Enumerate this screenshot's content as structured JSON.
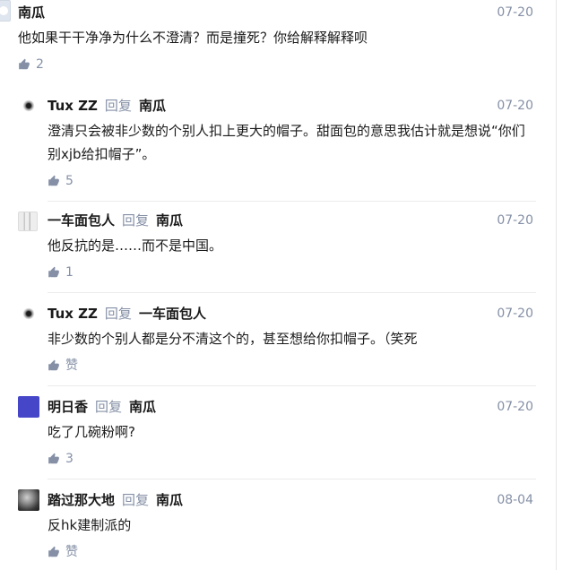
{
  "root_comment": {
    "author": "南瓜",
    "date": "07-20",
    "content": "他如果干干净净为什么不澄清？而是撞死？你给解释解释呗",
    "likes": "2"
  },
  "replies": [
    {
      "author": "Tux ZZ",
      "reply_label": "回复",
      "reply_to": "南瓜",
      "date": "07-20",
      "content": "澄清只会被非少数的个别人扣上更大的帽子。甜面包的意思我估计就是想说“你们别xjb给扣帽子”。",
      "likes": "5"
    },
    {
      "author": "一车面包人",
      "reply_label": "回复",
      "reply_to": "南瓜",
      "date": "07-20",
      "content": "他反抗的是……而不是中国。",
      "likes": "1"
    },
    {
      "author": "Tux ZZ",
      "reply_label": "回复",
      "reply_to": "一车面包人",
      "date": "07-20",
      "content": "非少数的个别人都是分不清这个的，甚至想给你扣帽子。（笑死",
      "likes": "赞"
    },
    {
      "author": "明日香",
      "reply_label": "回复",
      "reply_to": "南瓜",
      "date": "07-20",
      "content": "吃了几碗粉啊?",
      "likes": "3"
    },
    {
      "author": "踏过那大地",
      "reply_label": "回复",
      "reply_to": "南瓜",
      "date": "08-04",
      "content": "反hk建制派的",
      "likes": "赞"
    }
  ],
  "icons": {
    "like": "thumbs-up-icon"
  },
  "theme": {
    "text": "#1a1a1a",
    "muted": "#8590a6",
    "divider": "#ebebeb",
    "avatar-mingrixiang": "#4646c8"
  }
}
